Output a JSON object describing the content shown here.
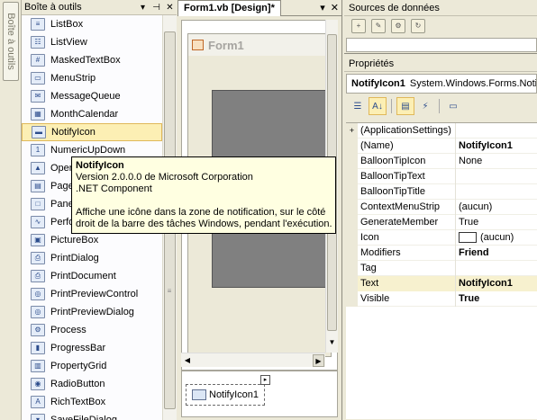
{
  "vertical_tab": {
    "label": "Boîte à outils"
  },
  "toolbox": {
    "title": "Boîte à outils",
    "items": [
      {
        "label": "ListBox",
        "icon": "listbox-icon",
        "glyph": "≡"
      },
      {
        "label": "ListView",
        "icon": "listview-icon",
        "glyph": "☷"
      },
      {
        "label": "MaskedTextBox",
        "icon": "maskedtextbox-icon",
        "glyph": "#"
      },
      {
        "label": "MenuStrip",
        "icon": "menustrip-icon",
        "glyph": "▭"
      },
      {
        "label": "MessageQueue",
        "icon": "messagequeue-icon",
        "glyph": "✉"
      },
      {
        "label": "MonthCalendar",
        "icon": "monthcalendar-icon",
        "glyph": "▦"
      },
      {
        "label": "NotifyIcon",
        "icon": "notifyicon-icon",
        "glyph": "▬"
      },
      {
        "label": "NumericUpDown",
        "icon": "numericupdown-icon",
        "glyph": "1"
      },
      {
        "label": "OpenFileDialog",
        "icon": "openfiledialog-icon",
        "glyph": "▲"
      },
      {
        "label": "PageSetupDialog",
        "icon": "pagesetupdialog-icon",
        "glyph": "▤"
      },
      {
        "label": "Panel",
        "icon": "panel-icon",
        "glyph": "□"
      },
      {
        "label": "PerformanceCounter",
        "icon": "performancecounter-icon",
        "glyph": "∿"
      },
      {
        "label": "PictureBox",
        "icon": "picturebox-icon",
        "glyph": "▣"
      },
      {
        "label": "PrintDialog",
        "icon": "printdialog-icon",
        "glyph": "⎙"
      },
      {
        "label": "PrintDocument",
        "icon": "printdocument-icon",
        "glyph": "⎙"
      },
      {
        "label": "PrintPreviewControl",
        "icon": "printpreviewcontrol-icon",
        "glyph": "◎"
      },
      {
        "label": "PrintPreviewDialog",
        "icon": "printpreviewdialog-icon",
        "glyph": "◎"
      },
      {
        "label": "Process",
        "icon": "process-icon",
        "glyph": "⚙"
      },
      {
        "label": "ProgressBar",
        "icon": "progressbar-icon",
        "glyph": "▮"
      },
      {
        "label": "PropertyGrid",
        "icon": "propertygrid-icon",
        "glyph": "▥"
      },
      {
        "label": "RadioButton",
        "icon": "radiobutton-icon",
        "glyph": "◉"
      },
      {
        "label": "RichTextBox",
        "icon": "richtextbox-icon",
        "glyph": "A"
      },
      {
        "label": "SaveFileDialog",
        "icon": "savefiledialog-icon",
        "glyph": "▾"
      }
    ],
    "selected_index": 6
  },
  "tooltip": {
    "title": "NotifyIcon",
    "version": "Version 2.0.0.0 de Microsoft Corporation",
    "component": ".NET Component",
    "desc1": "Affiche une icône dans la zone de notification, sur le côté",
    "desc2": "droit de la barre des tâches Windows, pendant l'exécution."
  },
  "designer": {
    "tab_label": "Form1.vb [Design]*",
    "form_title": "Form1",
    "tray_item": "NotifyIcon1"
  },
  "datasources": {
    "title": "Sources de données"
  },
  "properties": {
    "title": "Propriétés",
    "object_name": "NotifyIcon1",
    "object_type": "System.Windows.Forms.NotifyIcon",
    "rows": [
      {
        "name": "(ApplicationSettings)",
        "value": "",
        "expander": "+",
        "bold": false
      },
      {
        "name": "(Name)",
        "value": "NotifyIcon1",
        "expander": "",
        "bold": true
      },
      {
        "name": "BalloonTipIcon",
        "value": "None",
        "expander": "",
        "bold": false
      },
      {
        "name": "BalloonTipText",
        "value": "",
        "expander": "",
        "bold": false
      },
      {
        "name": "BalloonTipTitle",
        "value": "",
        "expander": "",
        "bold": false
      },
      {
        "name": "ContextMenuStrip",
        "value": "(aucun)",
        "expander": "",
        "bold": false
      },
      {
        "name": "GenerateMember",
        "value": "True",
        "expander": "",
        "bold": false
      },
      {
        "name": "Icon",
        "value": "(aucun)",
        "expander": "",
        "bold": false,
        "swatch": true
      },
      {
        "name": "Modifiers",
        "value": "Friend",
        "expander": "",
        "bold": true
      },
      {
        "name": "Tag",
        "value": "",
        "expander": "",
        "bold": false
      },
      {
        "name": "Text",
        "value": "NotifyIcon1",
        "expander": "",
        "bold": true,
        "highlight": true
      },
      {
        "name": "Visible",
        "value": "True",
        "expander": "",
        "bold": true
      }
    ]
  },
  "colors": {
    "chrome": "#ece9d8",
    "selected_item_bg": "#fcefb4",
    "tooltip_bg": "#ffffe1",
    "panel_gray": "#808080"
  }
}
